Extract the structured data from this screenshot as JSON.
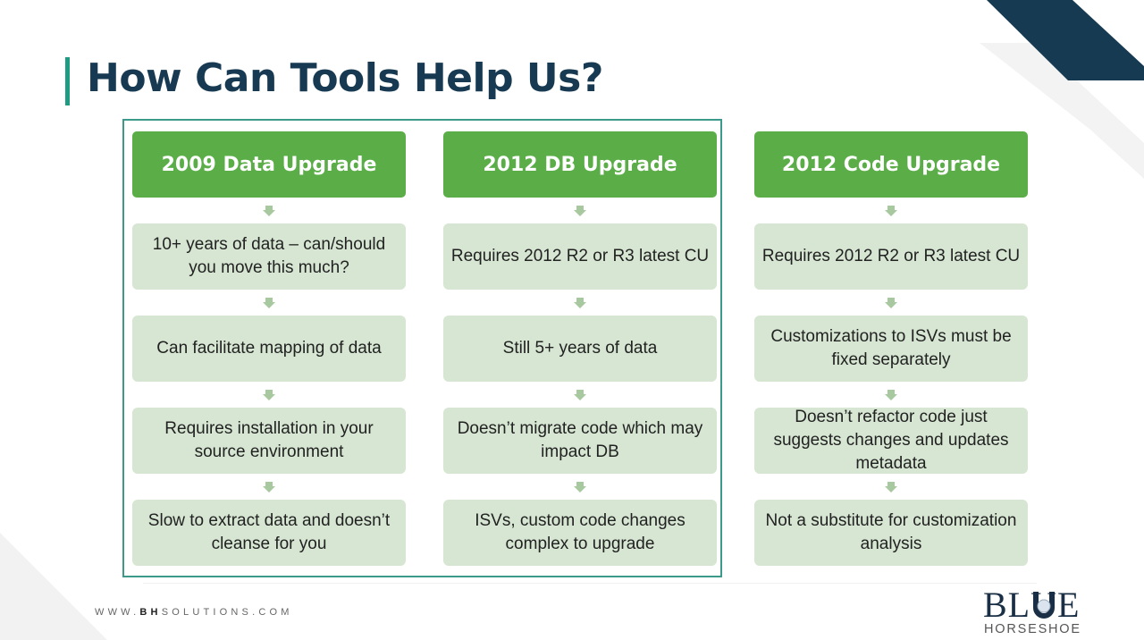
{
  "slide": {
    "title": "How Can Tools Help Us?",
    "website_prefix": "WWW.",
    "website_brand": "BH",
    "website_suffix": "SOLUTIONS.COM",
    "logo": {
      "line1": "BLUE",
      "line2": "HORSESHOE"
    },
    "colors": {
      "title": "#173a52",
      "accent_bar": "#1f9a83",
      "header_green": "#5aad47",
      "item_bg": "#d6e6d2",
      "frame": "#3c9a8a",
      "corner_navy": "#163a52"
    }
  },
  "columns": [
    {
      "header": "2009 Data Upgrade",
      "items": [
        "10+ years of data – can/should you move this much?",
        "Can facilitate mapping of data",
        "Requires installation in your source environment",
        "Slow to extract data and doesn’t cleanse for you"
      ]
    },
    {
      "header": "2012 DB Upgrade",
      "items": [
        "Requires 2012 R2 or R3 latest CU",
        "Still 5+ years of data",
        "Doesn’t migrate code which may impact DB",
        "ISVs, custom code changes complex to upgrade"
      ]
    },
    {
      "header": "2012 Code Upgrade",
      "items": [
        "Requires 2012 R2 or R3 latest CU",
        "Customizations to ISVs must be fixed separately",
        "Doesn’t refactor code just suggests changes and updates metadata",
        "Not a substitute for customization analysis"
      ]
    }
  ]
}
